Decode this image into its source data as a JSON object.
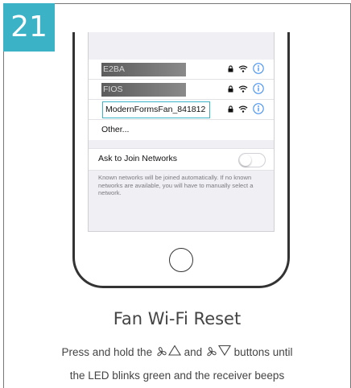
{
  "step": {
    "number": "21",
    "accent_color": "#3bb2c5"
  },
  "phone_screen": {
    "networks": [
      {
        "name": "E2BA",
        "redacted": true,
        "selected": false
      },
      {
        "name": "FIOS",
        "redacted": true,
        "selected": false
      },
      {
        "name": "ModernFormsFan_841812",
        "redacted": false,
        "selected": true
      }
    ],
    "network_icons": [
      "lock-icon",
      "wifi-icon",
      "info-icon"
    ],
    "other_label": "Other...",
    "ask_to_join_label": "Ask to Join Networks",
    "ask_to_join_enabled": false,
    "ask_to_join_hint": "Known networks will be joined automatically. If no known networks are available, you will have to manually select a network."
  },
  "title": "Fan Wi-Fi Reset",
  "instructions": {
    "line1_pre": "Press and hold the",
    "line1_and": "and",
    "line1_post": "buttons until",
    "line2": "the LED blinks green and the receiver beeps"
  }
}
